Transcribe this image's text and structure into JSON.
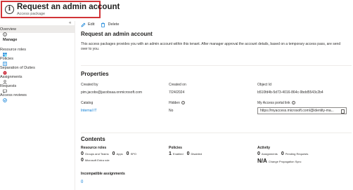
{
  "header": {
    "title": "Request an admin account",
    "subtitle": "Access package",
    "more": "···"
  },
  "sidebar": {
    "collapse": "«",
    "overview": "Overview",
    "section_manage": "Manage",
    "items": [
      {
        "label": "Resource roles",
        "icon": "resource-roles-icon"
      },
      {
        "label": "Policies",
        "icon": "policies-icon"
      },
      {
        "label": "Separation of Duties",
        "icon": "separation-icon"
      },
      {
        "label": "Assignments",
        "icon": "assignments-icon"
      },
      {
        "label": "Requests",
        "icon": "requests-icon"
      },
      {
        "label": "Access reviews",
        "icon": "access-reviews-icon"
      }
    ]
  },
  "toolbar": {
    "edit": "Edit",
    "delete": "Delete"
  },
  "main": {
    "heading": "Request an admin account",
    "description": "This access packages provides you with an admin account within this tenant. After manager approval the account details, based on a temporary access pass, are send over to you."
  },
  "properties": {
    "heading": "Properties",
    "created_by_label": "Created by",
    "created_by_value": "pim.jacobs@jacobsaa.onmicrosoft.com",
    "created_on_label": "Created on",
    "created_on_value": "7/24/2024",
    "object_id_label": "Object Id",
    "object_id_value": "b510fd4b-5d73-4016-864c-9bdd5543c2b4",
    "catalog_label": "Catalog",
    "catalog_value": "Internal IT",
    "hidden_label": "Hidden",
    "hidden_value": "No",
    "portal_link_label": "My Access portal link",
    "portal_link_value": "https://myaccess.microsoft.com/@identity-ma..."
  },
  "contents": {
    "heading": "Contents",
    "resource_roles": {
      "heading": "Resource roles",
      "groups_teams_count": "0",
      "groups_teams_label": "Groups and Teams",
      "apps_count": "0",
      "apps_label": "Apps",
      "spo_count": "0",
      "spo_label": "SPO",
      "entra_role_count": "0",
      "entra_role_label": "Microsoft Entra role"
    },
    "policies": {
      "heading": "Policies",
      "enabled_count": "1",
      "enabled_label": "Enabled",
      "disabled_count": "0",
      "disabled_label": "Disabled"
    },
    "activity": {
      "heading": "Activity",
      "assignments_count": "0",
      "assignments_label": "Assignments",
      "pending_count": "0",
      "pending_label": "Pending Requests",
      "sync_value": "N/A",
      "sync_label": "Change Propagation Sync"
    },
    "incompatible": {
      "heading": "Incompatible assignments",
      "count": "0"
    }
  }
}
